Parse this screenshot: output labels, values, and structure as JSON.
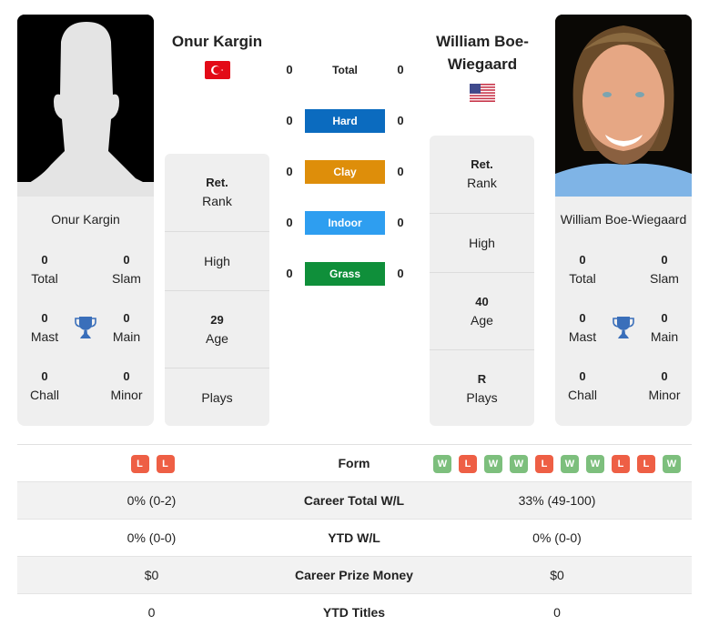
{
  "player1": {
    "name": "Onur Kargin",
    "card_name": "Onur Kargin",
    "flag": "turkey-flag",
    "titles": {
      "total": {
        "value": "0",
        "label": "Total"
      },
      "slam": {
        "value": "0",
        "label": "Slam"
      },
      "mast": {
        "value": "0",
        "label": "Mast"
      },
      "main": {
        "value": "0",
        "label": "Main"
      },
      "chall": {
        "value": "0",
        "label": "Chall"
      },
      "minor": {
        "value": "0",
        "label": "Minor"
      }
    },
    "info": {
      "rank": {
        "value": "Ret.",
        "label": "Rank"
      },
      "high": {
        "value": "",
        "label": "High"
      },
      "age": {
        "value": "29",
        "label": "Age"
      },
      "plays": {
        "value": "",
        "label": "Plays"
      }
    }
  },
  "player2": {
    "name": "William Boe-Wiegaard",
    "name_line1": "William Boe-",
    "name_line2": "Wiegaard",
    "card_name": "William Boe-Wiegaard",
    "flag": "usa-flag",
    "titles": {
      "total": {
        "value": "0",
        "label": "Total"
      },
      "slam": {
        "value": "0",
        "label": "Slam"
      },
      "mast": {
        "value": "0",
        "label": "Mast"
      },
      "main": {
        "value": "0",
        "label": "Main"
      },
      "chall": {
        "value": "0",
        "label": "Chall"
      },
      "minor": {
        "value": "0",
        "label": "Minor"
      }
    },
    "info": {
      "rank": {
        "value": "Ret.",
        "label": "Rank"
      },
      "high": {
        "value": "",
        "label": "High"
      },
      "age": {
        "value": "40",
        "label": "Age"
      },
      "plays": {
        "value": "R",
        "label": "Plays"
      }
    }
  },
  "surfaces": [
    {
      "label": "Total",
      "p1": "0",
      "p2": "0",
      "color": ""
    },
    {
      "label": "Hard",
      "p1": "0",
      "p2": "0",
      "color": "#0b6bbf"
    },
    {
      "label": "Clay",
      "p1": "0",
      "p2": "0",
      "color": "#de8e0a"
    },
    {
      "label": "Indoor",
      "p1": "0",
      "p2": "0",
      "color": "#2e9ef0"
    },
    {
      "label": "Grass",
      "p1": "0",
      "p2": "0",
      "color": "#0f8f3a"
    }
  ],
  "comparison": {
    "form_label": "Form",
    "p1_form": [
      "L",
      "L"
    ],
    "p2_form": [
      "W",
      "L",
      "W",
      "W",
      "L",
      "W",
      "W",
      "L",
      "L",
      "W"
    ],
    "rows": [
      {
        "label": "Career Total W/L",
        "p1": "0% (0-2)",
        "p2": "33% (49-100)"
      },
      {
        "label": "YTD W/L",
        "p1": "0% (0-0)",
        "p2": "0% (0-0)"
      },
      {
        "label": "Career Prize Money",
        "p1": "$0",
        "p2": "$0"
      },
      {
        "label": "YTD Titles",
        "p1": "0",
        "p2": "0"
      }
    ]
  },
  "colors": {
    "win": "#7dbf7d",
    "loss": "#ee5f45",
    "trophy": "#3a6fba"
  }
}
